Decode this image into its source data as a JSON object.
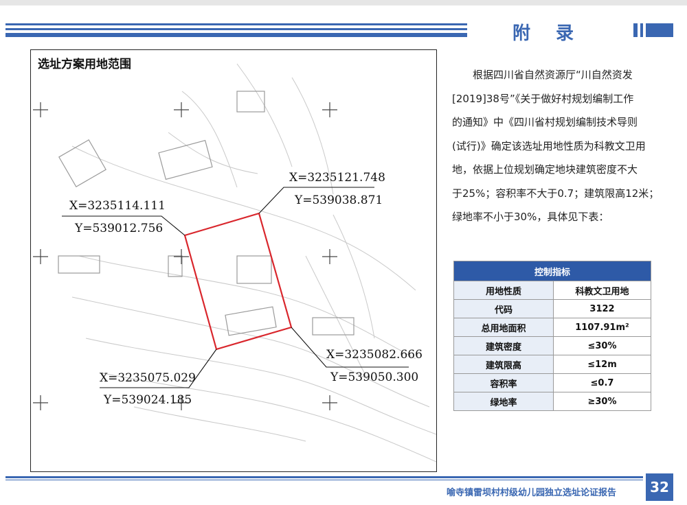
{
  "header": {
    "title": "附 录"
  },
  "map": {
    "title": "选址方案用地范围",
    "coords": {
      "nw_x": "X=3235114.111",
      "nw_y": "Y=539012.756",
      "ne_x": "X=3235121.748",
      "ne_y": "Y=539038.871",
      "sw_x": "X=3235075.029",
      "sw_y": "Y=539024.185",
      "se_x": "X=3235082.666",
      "se_y": "Y=539050.300"
    },
    "colors": {
      "boundary": "#d9262c"
    }
  },
  "paragraph": {
    "lines": [
      "根据四川省自然资源厅“川自然资发",
      "[2019]38号”《关于做好村规划编制工作",
      "的通知》中《四川省村规划编制技术导则",
      "(试行)》确定该选址用地性质为科教文卫用",
      "地，依据上位规划确定地块建筑密度不大",
      "于25%；容积率不大于0.7；建筑限高12米；",
      "绿地率不小于30%，具体见下表："
    ]
  },
  "table": {
    "header": "控制指标",
    "rows": [
      {
        "key": "用地性质",
        "value": "科教文卫用地"
      },
      {
        "key": "代码",
        "value": "3122"
      },
      {
        "key": "总用地面积",
        "value": "1107.91m²"
      },
      {
        "key": "建筑密度",
        "value": "≤30%"
      },
      {
        "key": "建筑限高",
        "value": "≤12m"
      },
      {
        "key": "容积率",
        "value": "≤0.7"
      },
      {
        "key": "绿地率",
        "value": "≥30%"
      }
    ]
  },
  "footer": {
    "text": "喻寺镇雷坝村村级幼儿园独立选址论证报告",
    "page": "32"
  },
  "colors": {
    "accent": "#3a67b2",
    "table_header": "#2e5aa7"
  }
}
